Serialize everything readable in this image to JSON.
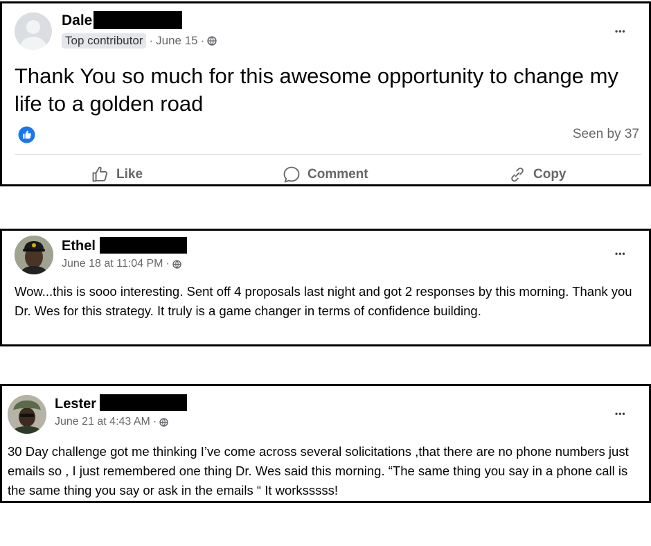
{
  "posts": [
    {
      "author": "Dale",
      "badge": "Top contributor",
      "sep1": "·",
      "date": "June 15",
      "sep2": "·",
      "body": "Thank You so much for this awesome opportunity to change my life to a golden road",
      "seen": "Seen by 37",
      "actions": {
        "like": "Like",
        "comment": "Comment",
        "copy": "Copy"
      }
    },
    {
      "author": "Ethel",
      "date": "June 18 at 11:04 PM",
      "sep": "·",
      "body": "Wow...this is sooo interesting. Sent off 4 proposals last night and got 2 responses by this morning. Thank you Dr. Wes for this strategy. It truly is a game changer in terms of confidence building."
    },
    {
      "author": "Lester",
      "date": "June 21 at 4:43 AM",
      "sep": "·",
      "body": "30 Day challenge got me thinking I’ve come across several solicitations ,that there are no phone numbers just emails so , I just remembered one thing Dr. Wes said this morning.  “The same thing you say in a phone call is the same thing you say or ask in the emails “ It worksssss!"
    }
  ],
  "more_glyph": "•••",
  "colors": {
    "like_blue": "#1877f2",
    "meta_gray": "#65676b",
    "border": "#000000"
  }
}
